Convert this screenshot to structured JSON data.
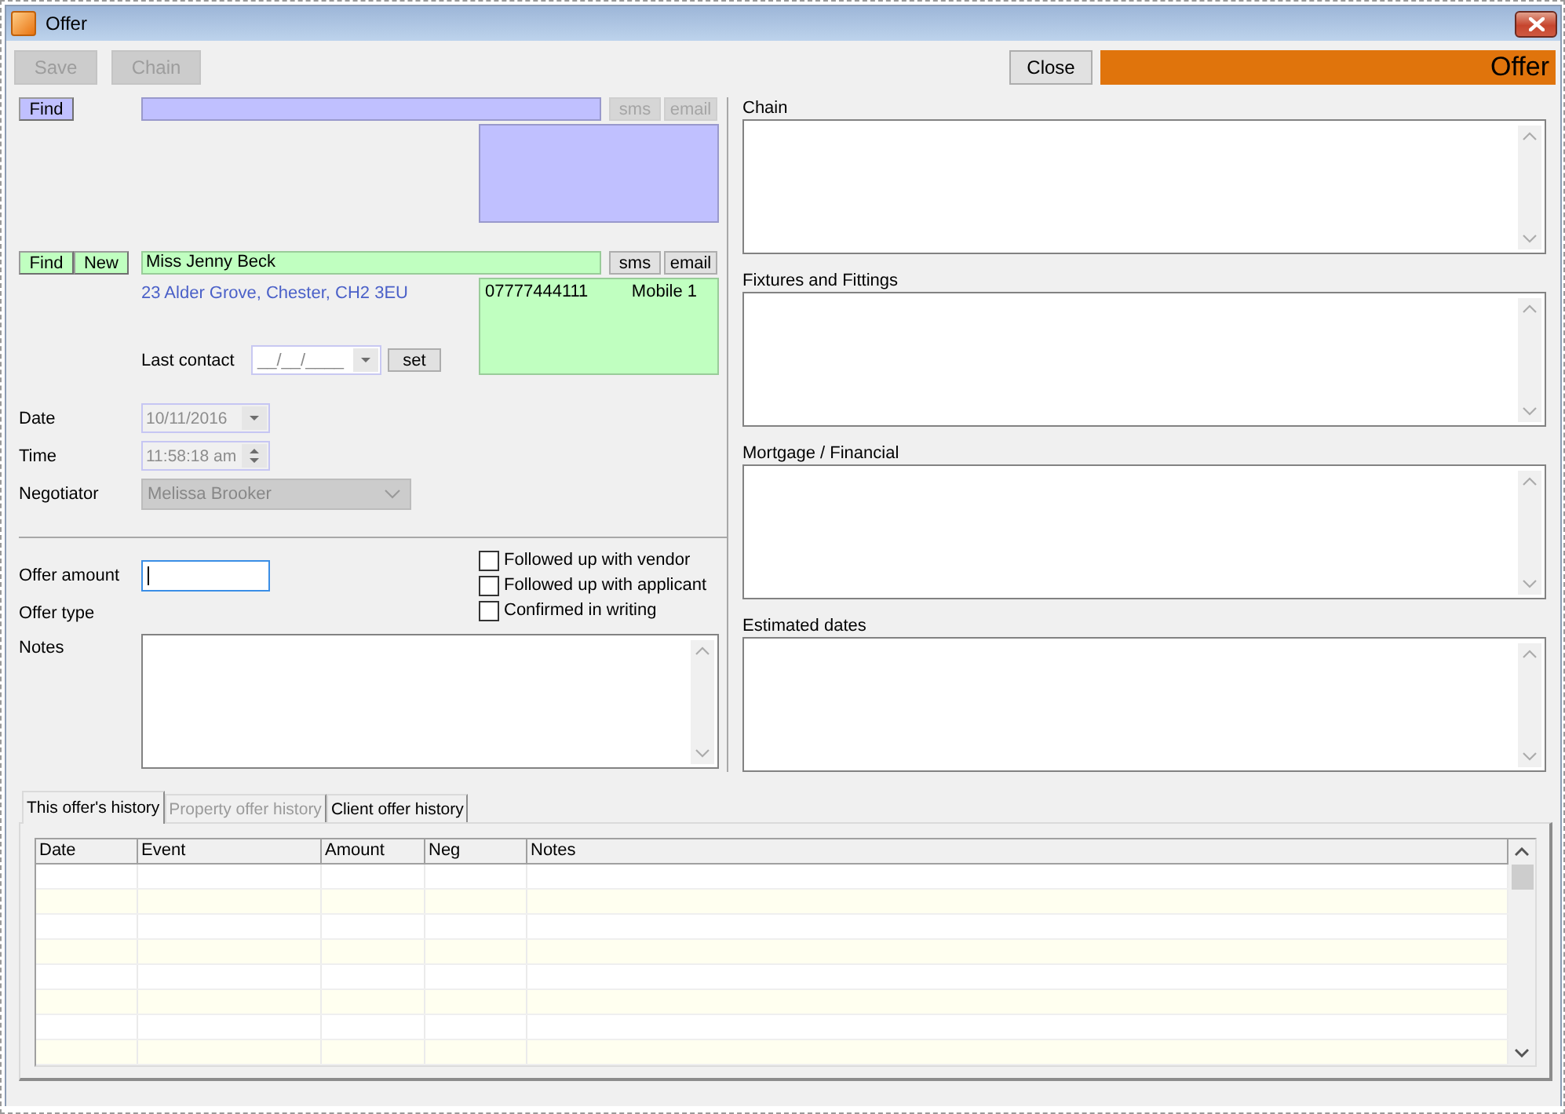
{
  "window": {
    "title": "Offer"
  },
  "toolbar": {
    "buttons": [
      {
        "label": "Save",
        "disabled": true
      },
      {
        "label": "Chain",
        "disabled": true
      }
    ],
    "close_button": {
      "label": "Close",
      "disabled": false
    },
    "banner": "Offer"
  },
  "contacts": [
    {
      "color": "#c0c0ff",
      "buttons": [
        {
          "label": "Find",
          "disabled": false
        }
      ],
      "message_buttons": [
        {
          "label": "sms",
          "disabled": true
        },
        {
          "label": "email",
          "disabled": true
        }
      ]
    },
    {
      "color": "#c0ffc0",
      "buttons": [
        {
          "label": "Find",
          "disabled": false
        },
        {
          "label": "New",
          "disabled": false
        }
      ],
      "name": "Miss Jenny Beck",
      "message_buttons": [
        {
          "label": "sms",
          "disabled": false
        },
        {
          "label": "email",
          "disabled": false
        }
      ],
      "address": "23 Alder Grove, Chester, CH2 3EU",
      "phones": [
        {
          "number": "07777444111",
          "type": "Mobile 1"
        }
      ],
      "last_contact": {
        "label": "Last contact",
        "placeholder": "__/__/____",
        "button": "set"
      }
    }
  ],
  "details": [
    {
      "kind": "date",
      "label": "Date",
      "value": "10/11/2016",
      "disabled": true
    },
    {
      "kind": "time",
      "label": "Time",
      "value": "11:58:18 am",
      "disabled": true
    },
    {
      "kind": "select",
      "label": "Negotiator",
      "value": "Melissa Brooker",
      "disabled": true
    }
  ],
  "offer": {
    "amount": {
      "label": "Offer amount",
      "focused": true
    },
    "type_label": "Offer type",
    "checks": [
      {
        "label": "Followed up with vendor",
        "checked": false
      },
      {
        "label": "Followed up with applicant",
        "checked": false
      },
      {
        "label": "Confirmed in writing",
        "checked": false
      }
    ],
    "notes_label": "Notes"
  },
  "memos": [
    {
      "label": "Chain"
    },
    {
      "label": "Fixtures and Fittings"
    },
    {
      "label": "Mortgage / Financial"
    },
    {
      "label": "Estimated dates"
    }
  ],
  "history": {
    "tabs": [
      {
        "label": "This offer's history",
        "selected": true,
        "disabled": false
      },
      {
        "label": "Property offer history",
        "selected": false,
        "disabled": true
      },
      {
        "label": "Client offer history",
        "selected": false,
        "disabled": false
      }
    ],
    "table": {
      "columns": [
        "Date",
        "Event",
        "Amount",
        "Neg",
        "Notes"
      ]
    }
  }
}
